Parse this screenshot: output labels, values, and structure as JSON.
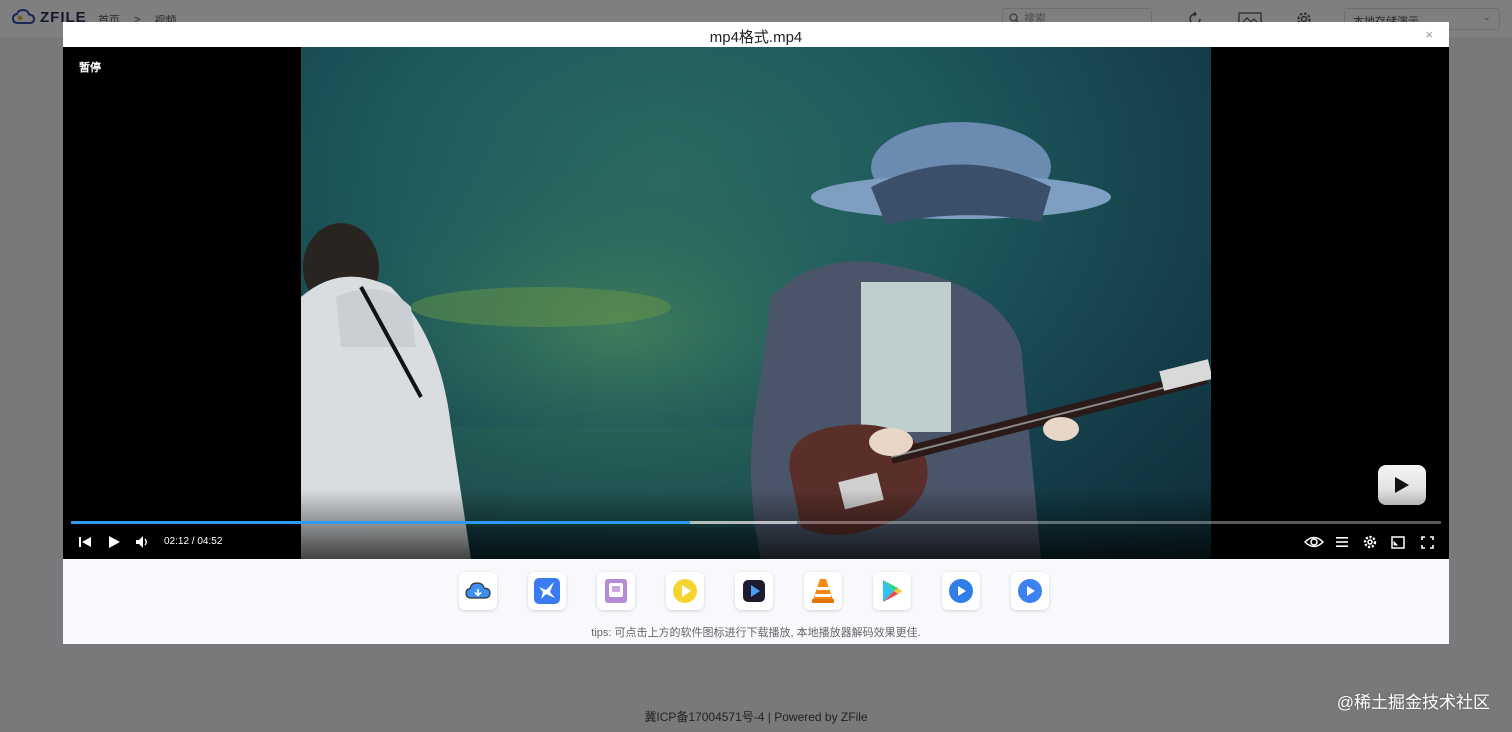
{
  "app": {
    "logo_text": "ZFILE",
    "breadcrumb": [
      "首页",
      "视频"
    ],
    "search_placeholder": "搜索",
    "storage_selected": "本地存储演示"
  },
  "dialog": {
    "title": "mp4格式.mp4",
    "close_label": "×"
  },
  "player": {
    "state_label": "暂停",
    "current_time": "02:12",
    "duration": "04:52",
    "time_display": "02:12 / 04:52",
    "played_fraction": 0.452,
    "loaded_fraction": 0.53,
    "accent_color": "#2d9cf0"
  },
  "app_icons": [
    "cloud-download-icon",
    "thunder-bird-icon",
    "potplayer-icon",
    "yellow-play-icon",
    "iina-icon",
    "vlc-icon",
    "google-play-icon",
    "blue-play-icon",
    "blue-play-alt-icon"
  ],
  "tips": "tips: 可点击上方的软件图标进行下载播放, 本地播放器解码效果更佳.",
  "footer": "冀ICP备17004571号-4 | Powered by ZFile",
  "watermark": "@稀土掘金技术社区"
}
